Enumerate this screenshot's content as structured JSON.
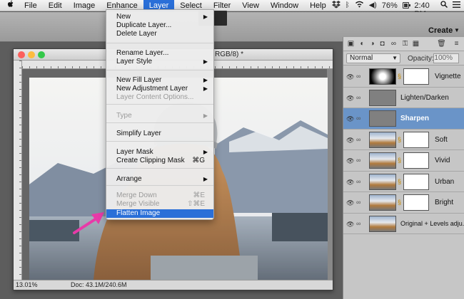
{
  "menubar": {
    "items": [
      "File",
      "Edit",
      "Image",
      "Enhance",
      "Layer",
      "Select",
      "Filter",
      "View",
      "Window",
      "Help"
    ],
    "active_item": "Layer",
    "battery": "76%",
    "clock": "Tue 2:40 PM"
  },
  "topbar": {
    "dark_button_text": "t",
    "create_label": "Create"
  },
  "document": {
    "title_suffix": "RGB/8) *",
    "zoom": "13.01%",
    "doc_info": "Doc: 43.1M/240.6M"
  },
  "layer_menu": {
    "items": [
      {
        "label": "New",
        "submenu": true,
        "disabled": false
      },
      {
        "label": "Duplicate Layer...",
        "disabled": false
      },
      {
        "label": "Delete Layer",
        "disabled": false
      },
      {
        "label": "Rename Layer...",
        "disabled": false
      },
      {
        "label": "Layer Style",
        "submenu": true,
        "disabled": false
      },
      {
        "label": "New Fill Layer",
        "submenu": true,
        "disabled": false
      },
      {
        "label": "New Adjustment Layer",
        "submenu": true,
        "disabled": false
      },
      {
        "label": "Layer Content Options...",
        "disabled": true
      },
      {
        "label": "Type",
        "submenu": true,
        "disabled": true
      },
      {
        "label": "Simplify Layer",
        "disabled": false
      },
      {
        "label": "Layer Mask",
        "submenu": true,
        "disabled": false
      },
      {
        "label": "Create Clipping Mask",
        "shortcut": "⌘G",
        "disabled": false
      },
      {
        "label": "Arrange",
        "submenu": true,
        "disabled": false
      },
      {
        "label": "Merge Down",
        "shortcut": "⌘E",
        "disabled": true
      },
      {
        "label": "Merge Visible",
        "shortcut": "⇧⌘E",
        "disabled": true
      },
      {
        "label": "Flatten Image",
        "disabled": false,
        "highlighted": true
      }
    ]
  },
  "layers_panel": {
    "blend_mode": "Normal",
    "opacity_label": "Opacity:",
    "opacity_value": "100%",
    "layers": [
      {
        "name": "Vignette",
        "thumb": "gradient",
        "mask": true,
        "selected": false
      },
      {
        "name": "Lighten/Darken",
        "thumb": "gray",
        "mask": false,
        "selected": false
      },
      {
        "name": "Sharpen",
        "thumb": "gray",
        "mask": false,
        "selected": true
      },
      {
        "name": "Soft",
        "thumb": "photo",
        "mask": true,
        "selected": false
      },
      {
        "name": "Vivid",
        "thumb": "photo",
        "mask": true,
        "selected": false
      },
      {
        "name": "Urban",
        "thumb": "photo",
        "mask": true,
        "selected": false
      },
      {
        "name": "Bright",
        "thumb": "photo",
        "mask": true,
        "selected": false
      },
      {
        "name": "Original + Levels adju...",
        "thumb": "photo",
        "mask": false,
        "selected": false
      }
    ]
  },
  "colors": {
    "menu_highlight": "#2a6fd8",
    "selected_layer": "#6a94c8",
    "arrow": "#e83aa8"
  }
}
